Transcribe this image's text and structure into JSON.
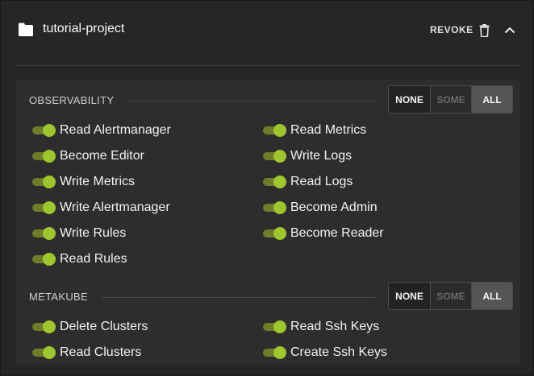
{
  "project": {
    "name": "tutorial-project",
    "icon": "folder-icon"
  },
  "header": {
    "revoke_label": "REVOKE",
    "trash_icon": "trash-icon",
    "collapse_icon": "chevron-up-icon"
  },
  "colors": {
    "toggle_on_knob": "#9fc62f",
    "toggle_on_track": "#6f7d2a",
    "background": "#262626"
  },
  "sections": [
    {
      "title": "OBSERVABILITY",
      "selector": {
        "options": [
          "NONE",
          "SOME",
          "ALL"
        ],
        "selected": "ALL"
      },
      "permissions_left": [
        {
          "label": "Read Alertmanager",
          "enabled": true
        },
        {
          "label": "Become Editor",
          "enabled": true
        },
        {
          "label": "Write Metrics",
          "enabled": true
        },
        {
          "label": "Write Alertmanager",
          "enabled": true
        },
        {
          "label": "Write Rules",
          "enabled": true
        },
        {
          "label": "Read Rules",
          "enabled": true
        }
      ],
      "permissions_right": [
        {
          "label": "Read Metrics",
          "enabled": true
        },
        {
          "label": "Write Logs",
          "enabled": true
        },
        {
          "label": "Read Logs",
          "enabled": true
        },
        {
          "label": "Become Admin",
          "enabled": true
        },
        {
          "label": "Become Reader",
          "enabled": true
        }
      ]
    },
    {
      "title": "METAKUBE",
      "selector": {
        "options": [
          "NONE",
          "SOME",
          "ALL"
        ],
        "selected": "ALL"
      },
      "permissions_left": [
        {
          "label": "Delete Clusters",
          "enabled": true
        },
        {
          "label": "Read Clusters",
          "enabled": true
        }
      ],
      "permissions_right": [
        {
          "label": "Read Ssh Keys",
          "enabled": true
        },
        {
          "label": "Create Ssh Keys",
          "enabled": true
        }
      ]
    }
  ]
}
